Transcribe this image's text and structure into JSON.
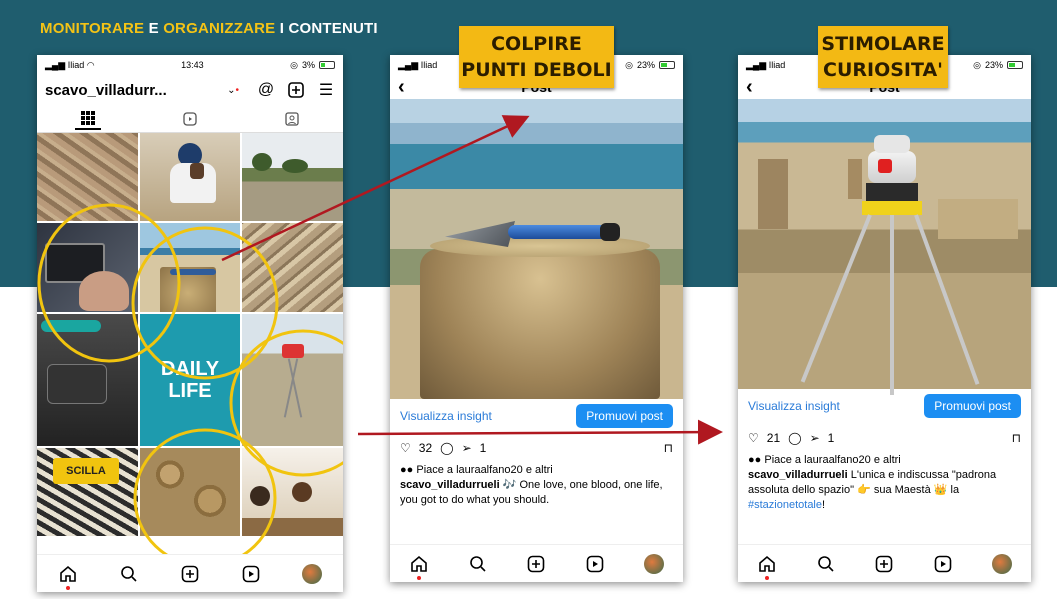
{
  "slide": {
    "title_part1": "MONITORARE",
    "title_part2": " E ",
    "title_part3": "ORGANIZZARE",
    "title_part4": " I CONTENUTI",
    "callout1_line1": "COLPIRE",
    "callout1_line2": "PUNTI DEBOLI",
    "callout2_line1": "STIMOLARE",
    "callout2_line2": "CURIOSITA'"
  },
  "colors": {
    "band": "#1f5d6e",
    "accent_yellow": "#f3c316",
    "arrow_red": "#b01820",
    "link_blue": "#2a7bd8"
  },
  "phone1": {
    "carrier": "Iliad",
    "time": "13:43",
    "battery": "3%",
    "username": "scavo_villadurr...",
    "grid_captions": {
      "daily": "DAILY LIFE",
      "scilla": "SCILLA"
    }
  },
  "phone2": {
    "carrier": "Iliad",
    "battery": "23%",
    "header": "Post",
    "insight_link": "Visualizza insight",
    "promote_button": "Promuovi post",
    "likes_count": "32",
    "shares_count": "1",
    "liked_by": "Piace a lauraalfano20 e altri",
    "caption_user": "scavo_villadurrueli",
    "caption_text": " 🎶 One love, one blood, one life, you got to do what you should."
  },
  "phone3": {
    "carrier": "Iliad",
    "battery": "23%",
    "header": "Post",
    "insight_link": "Visualizza insight",
    "promote_button": "Promuovi post",
    "likes_count": "21",
    "shares_count": "1",
    "liked_by": "Piace a lauraalfano20 e altri",
    "caption_user": "scavo_villadurrueli",
    "caption_text": " L'unica e indiscussa \"padrona assoluta dello spazio\" 👉 sua Maestà 👑 la ",
    "caption_tag": "#stazionetotale",
    "caption_end": "!"
  }
}
